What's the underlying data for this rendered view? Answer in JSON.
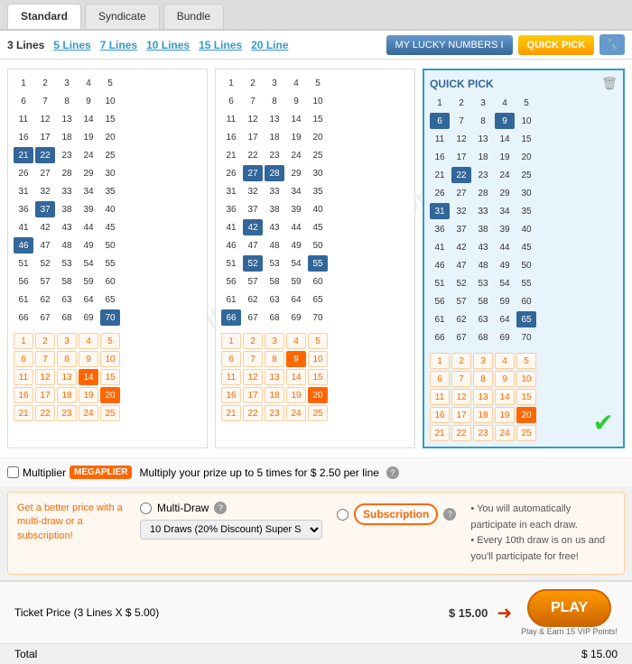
{
  "tabs": [
    {
      "label": "Standard",
      "active": true
    },
    {
      "label": "Syndicate",
      "active": false
    },
    {
      "label": "Bundle",
      "active": false
    }
  ],
  "lineTabs": [
    {
      "label": "3 Lines",
      "active": true
    },
    {
      "label": "5 Lines"
    },
    {
      "label": "7 Lines"
    },
    {
      "label": "10 Lines"
    },
    {
      "label": "15 Lines"
    },
    {
      "label": "20 Line"
    }
  ],
  "buttons": {
    "myLucky": "MY LUCKY NUMBERS I",
    "quickPick": "QUICK PICK"
  },
  "quickPickTitle": "QUICK PICK",
  "multiplier": {
    "label": "Multiplier",
    "badge": "MEGAPLIER",
    "description": "Multiply your prize up to 5 times for $ 2.50 per line"
  },
  "subscription": {
    "leftText": "Get a better price with a multi-draw or a subscription!",
    "multiDraw": "Multi-Draw",
    "multiDrawOption": "10 Draws (20% Discount) Super S",
    "subscriptionLabel": "Subscription",
    "bullet1": "You will automatically participate in each draw.",
    "bullet2": "Every 10th draw is on us and you'll participate for free!"
  },
  "ticket": {
    "priceLabel": "Ticket Price (3 Lines X $ 5.00)",
    "price": "$ 15.00",
    "totalLabel": "Total",
    "total": "$ 15.00"
  },
  "play": {
    "label": "PLAY",
    "note": "Play & Earn 15 VIP Points!"
  },
  "watermark": "InternationalLottery.org",
  "grid1": {
    "selected": [
      21,
      22,
      37,
      46,
      70
    ],
    "orangeSelected": [
      14,
      20
    ]
  },
  "grid2": {
    "selected": [
      27,
      28,
      42,
      52,
      55,
      66
    ],
    "orangeSelected": [
      9,
      20
    ]
  },
  "grid3": {
    "selected": [
      6,
      9,
      22,
      31,
      65
    ],
    "orangeSelected": [
      20
    ]
  }
}
